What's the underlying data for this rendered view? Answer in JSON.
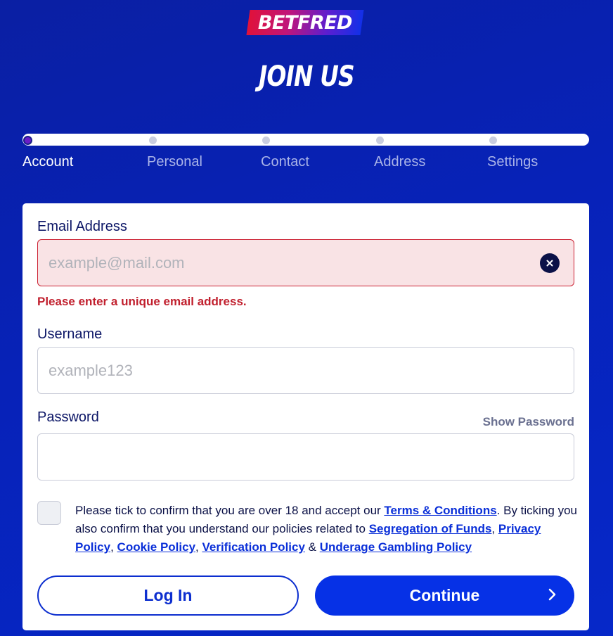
{
  "brand": {
    "logo_text": "BETFRED"
  },
  "header": {
    "title": "JOIN US"
  },
  "steps": [
    {
      "label": "Account",
      "active": true
    },
    {
      "label": "Personal",
      "active": false
    },
    {
      "label": "Contact",
      "active": false
    },
    {
      "label": "Address",
      "active": false
    },
    {
      "label": "Settings",
      "active": false
    }
  ],
  "form": {
    "email": {
      "label": "Email Address",
      "placeholder": "example@mail.com",
      "value": "",
      "error": "Please enter a unique email address.",
      "clear_icon": "close-icon"
    },
    "username": {
      "label": "Username",
      "placeholder": "example123",
      "value": ""
    },
    "password": {
      "label": "Password",
      "value": "",
      "show_label": "Show Password"
    },
    "terms": {
      "checked": false,
      "text_1": "Please tick to confirm that you are over 18 and accept our ",
      "link_terms": "Terms & Conditions",
      "text_2": ". By ticking you also confirm that you understand our policies related to ",
      "link_segregation": "Segregation of Funds",
      "sep_1": ", ",
      "link_privacy": "Privacy Policy",
      "sep_2": ", ",
      "link_cookie": "Cookie Policy",
      "sep_3": ", ",
      "link_verification": "Verification Policy",
      "sep_4": " & ",
      "link_underage": "Underage Gambling Policy"
    },
    "buttons": {
      "login_label": "Log In",
      "continue_label": "Continue"
    }
  },
  "colors": {
    "background": "#0722b8",
    "accent": "#0631e6",
    "error": "#c1202e",
    "error_bg": "#f9e3e5"
  }
}
